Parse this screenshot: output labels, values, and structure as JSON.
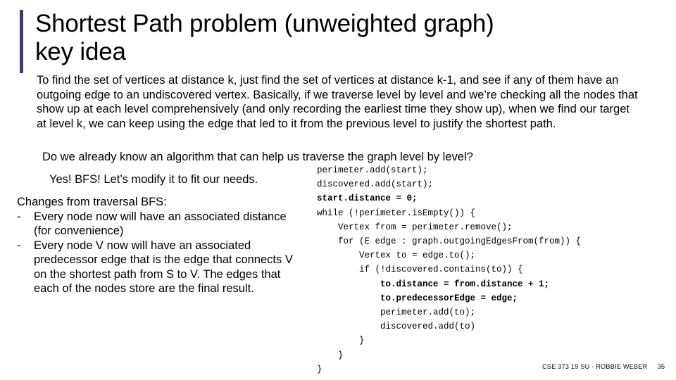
{
  "slide": {
    "accent_color": "#463a5e",
    "title": "Shortest Path problem (unweighted graph)\nkey idea",
    "paragraph_1": "To find the set of vertices at distance k, just find the set of vertices at distance k-1, and see if any of them have an outgoing edge to an undiscovered vertex. Basically, if we traverse level by level and we’re checking all the nodes that show up at each level comprehensively (and only recording the earliest time they show up), when we find our target at level k, we can keep using the edge that led to it from the previous level to justify the shortest path.",
    "paragraph_2": "Do we already know an algorithm that can help us traverse the graph level by level?",
    "paragraph_3": "Yes! BFS! Let’s modify it to fit our needs.",
    "changes": {
      "heading": "Changes from traversal BFS:",
      "bullet_marker": "-",
      "items": [
        "Every node now will have an associated distance (for convenience)",
        "Every node V now will have an associated predecessor edge that is the edge that connects V on the shortest path from S to V. The edges that each of the nodes store are the final result."
      ]
    },
    "code": {
      "lines": [
        {
          "text": "perimeter.add(start);",
          "bold": false
        },
        {
          "text": "discovered.add(start);",
          "bold": false
        },
        {
          "text": "start.distance = 0;",
          "bold": true
        },
        {
          "text": "while (!perimeter.isEmpty()) {",
          "bold": false
        },
        {
          "text": "    Vertex from = perimeter.remove();",
          "bold": false
        },
        {
          "text": "    for (E edge : graph.outgoingEdgesFrom(from)) {",
          "bold": false
        },
        {
          "text": "        Vertex to = edge.to();",
          "bold": false
        },
        {
          "text": "        if (!discovered.contains(to)) {",
          "bold": false
        },
        {
          "text": "            to.distance = from.distance + 1;",
          "bold": true
        },
        {
          "text": "            to.predecessorEdge = edge;",
          "bold": true
        },
        {
          "text": "            perimeter.add(to);",
          "bold": false
        },
        {
          "text": "            discovered.add(to)",
          "bold": false
        },
        {
          "text": "        }",
          "bold": false
        },
        {
          "text": "    }",
          "bold": false
        },
        {
          "text": "}",
          "bold": false
        }
      ]
    },
    "footer": {
      "credit": "CSE 373 19 SU - ROBBIE WEBER",
      "page_number": "35"
    }
  }
}
